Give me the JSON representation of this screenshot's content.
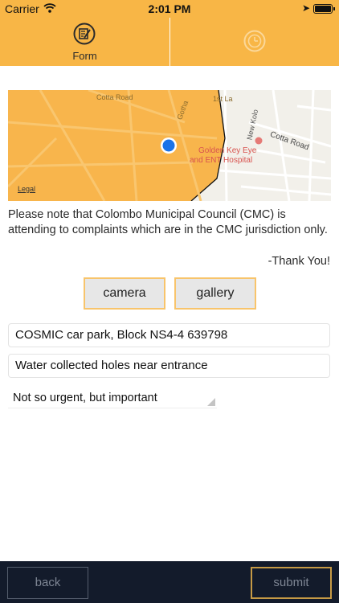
{
  "status_bar": {
    "carrier": "Carrier",
    "time": "2:01 PM"
  },
  "tabs": [
    {
      "label": "Form",
      "icon": "form-edit-icon",
      "active": true
    },
    {
      "label": "",
      "icon": "clock-history-icon",
      "active": false
    }
  ],
  "map": {
    "legal": "Legal",
    "roads": [
      "Cotta Road",
      "New Kolonnawa Road"
    ],
    "place_line1": "Golden Key Eye",
    "place_line2": "and ENT Hospital",
    "road_label_1": "Cotta Road",
    "road_label_2": "Cotta Road",
    "road_label_3": "New Kolo",
    "road_label_4": "Gotha",
    "road_label_5": "1st La"
  },
  "notice": "Please note that Colombo Municipal Council (CMC) is attending to complaints which are in the CMC jurisdiction only.",
  "thanks": "-Thank You!",
  "buttons": {
    "camera": "camera",
    "gallery": "gallery"
  },
  "form": {
    "location": "COSMIC car park, Block NS4-4 639798",
    "description": "Water collected holes near entrance",
    "urgency": "Not so urgent, but important"
  },
  "bottom": {
    "back": "back",
    "submit": "submit"
  },
  "colors": {
    "accent": "#f8b646",
    "bottom_bar": "#131b2b",
    "button_border": "#f8c46b",
    "location_dot": "#1a73e8"
  }
}
